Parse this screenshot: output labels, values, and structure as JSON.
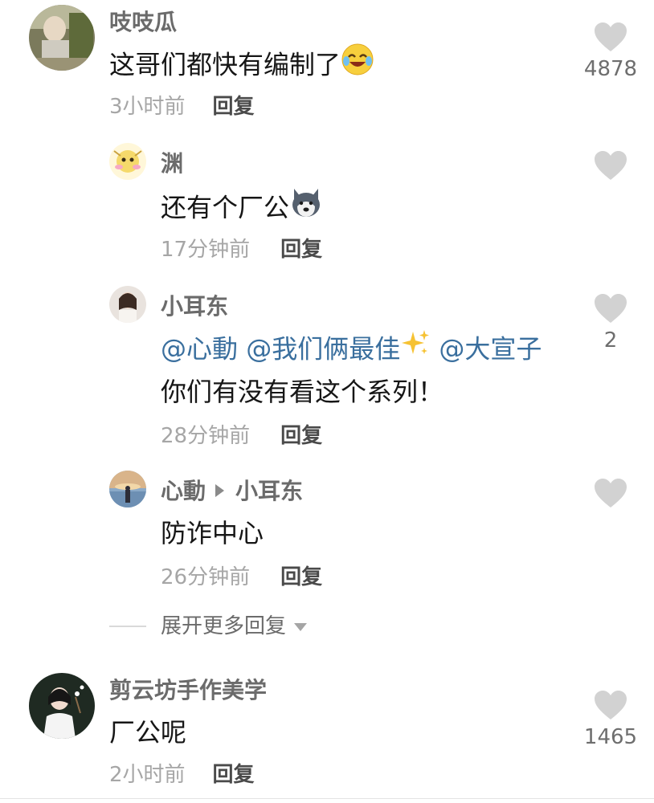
{
  "comments": [
    {
      "username": "吱吱瓜",
      "text": "这哥们都快有编制了",
      "time": "3小时前",
      "reply": "回复",
      "likes": "4878"
    },
    {
      "username": "渊",
      "text": "还有个厂公",
      "time": "17分钟前",
      "reply": "回复",
      "likes": ""
    },
    {
      "username": "小耳东",
      "mentions": [
        "@心動",
        "@我们俩最佳",
        "@大宣子"
      ],
      "text": "你们有没有看这个系列！",
      "time": "28分钟前",
      "reply": "回复",
      "likes": "2"
    },
    {
      "username": "心動",
      "reply_to": "小耳东",
      "text": "防诈中心",
      "time": "26分钟前",
      "reply": "回复",
      "likes": ""
    },
    {
      "username": "剪云坊手作美学",
      "text": "厂公呢",
      "time": "2小时前",
      "reply": "回复",
      "likes": "1465"
    }
  ],
  "expand_replies": "展开更多回复",
  "colors": {
    "username": "#6b6b6b",
    "text": "#161616",
    "mention": "#3a6f9e",
    "time": "#a6a6a6",
    "heart": "#d2d2d2"
  },
  "icons": {
    "like": "heart-icon",
    "laugh_emoji": "laughing-crying-emoji",
    "dog_emoji": "husky-dog-emoji",
    "sparkle_emoji": "sparkles-emoji",
    "reply_arrow": "triangle-right-icon",
    "expand": "chevron-down-icon"
  }
}
